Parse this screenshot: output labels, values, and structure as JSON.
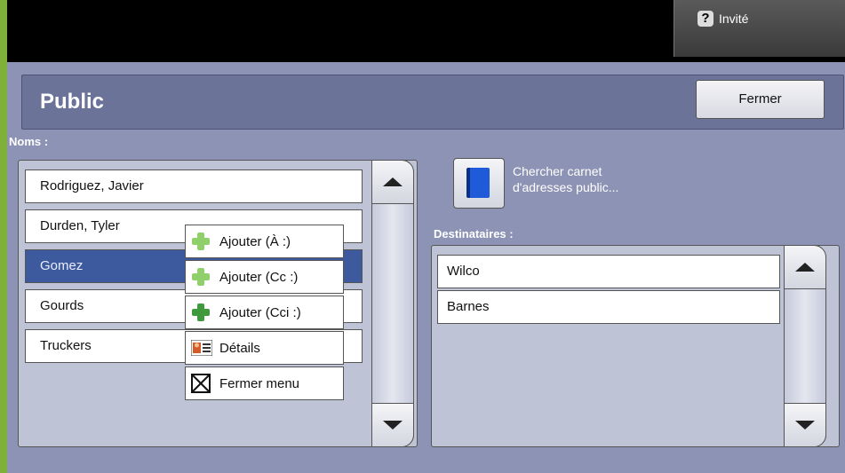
{
  "topbar": {
    "user_label": "Invité",
    "help_icon": "question-mark-icon"
  },
  "header": {
    "title": "Public",
    "close_label": "Fermer"
  },
  "names": {
    "label": "Noms :",
    "items": [
      "Rodriguez, Javier",
      "Durden, Tyler",
      "Gomez",
      "Gourds",
      "Truckers"
    ],
    "selected": "Gomez"
  },
  "context_menu": {
    "items": [
      {
        "label": "Ajouter (À :)",
        "icon": "add-to-icon"
      },
      {
        "label": "Ajouter (Cc :)",
        "icon": "add-cc-icon"
      },
      {
        "label": "Ajouter (Cci :)",
        "icon": "add-bcc-icon"
      },
      {
        "label": "Détails",
        "icon": "details-card-icon"
      },
      {
        "label": "Fermer menu",
        "icon": "close-box-icon"
      }
    ]
  },
  "search": {
    "label_line1": "Chercher carnet",
    "label_line2": "d'adresses public..."
  },
  "recipients": {
    "label": "Destinataires :",
    "items": [
      "Wilco",
      "Barnes"
    ]
  },
  "colors": {
    "accent_green": "#7fb03a",
    "panel": "#8c93b4",
    "selected": "#3e5a9e"
  }
}
